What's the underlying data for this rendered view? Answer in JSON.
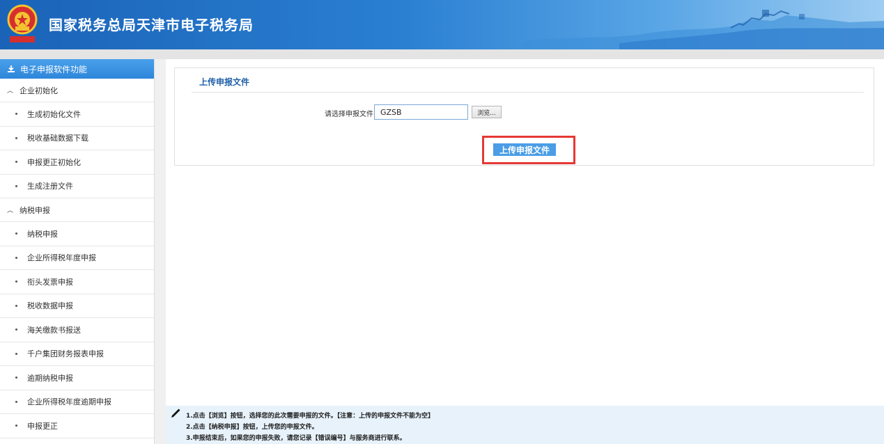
{
  "header": {
    "title": "国家税务总局天津市电子税务局"
  },
  "sidebar": {
    "heading": "电子申报软件功能",
    "groups": [
      {
        "label": "企业初始化",
        "items": [
          "生成初始化文件",
          "税收基础数据下载",
          "申报更正初始化",
          "生成注册文件"
        ]
      },
      {
        "label": "纳税申报",
        "items": [
          "纳税申报",
          "企业所得税年度申报",
          "衔头发票申报",
          "税收数据申报",
          "海关缴款书报送",
          "千户集团财务报表申报",
          "逾期纳税申报",
          "企业所得税年度逾期申报",
          "申报更正"
        ]
      }
    ]
  },
  "main": {
    "card_title": "上传申报文件",
    "file_label": "请选择申报文件：",
    "file_value": "GZSB",
    "browse_label": "浏览...",
    "upload_label": "上传申报文件"
  },
  "instructions": [
    "1.点击【浏览】按钮，选择您的此次需要申报的文件。【注意：上传的申报文件不能为空】",
    "2.点击【纳税申报】按钮，上传您的申报文件。",
    "3.申报结束后，如果您的申报失败，请您记录【错误编号】与服务商进行联系。"
  ],
  "colors": {
    "header_blue": "#1a63b8",
    "accent": "#4a9de6",
    "highlight": "#e53935"
  }
}
